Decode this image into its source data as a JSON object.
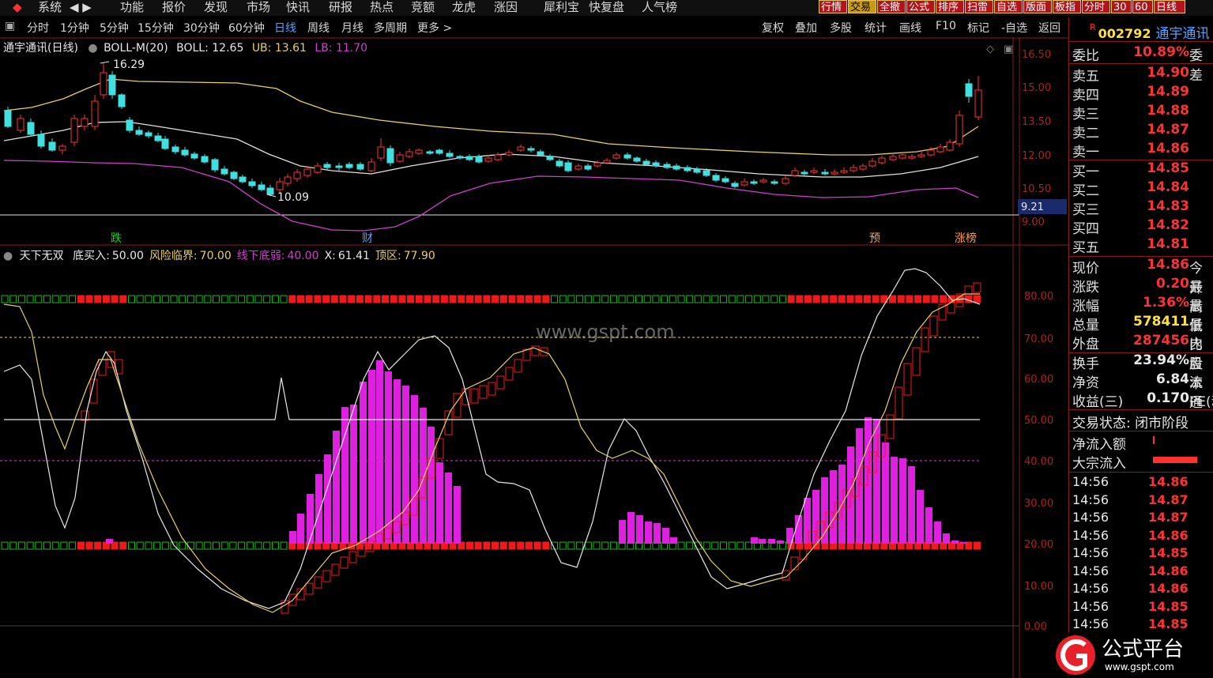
{
  "menu": {
    "left_items": [
      "系统",
      "功能",
      "报价",
      "发现",
      "市场",
      "快讯",
      "研报",
      "热点",
      "竞额",
      "龙虎",
      "涨因",
      "犀利宝",
      "快复盘",
      "人气榜"
    ],
    "right_buttons": [
      "行情",
      "交易",
      "全撤",
      "公式",
      "排序",
      "扫雷",
      "自选",
      "版面",
      "板指",
      "分时",
      "30",
      "60",
      "日线"
    ]
  },
  "toolbar": {
    "periods": [
      "分时",
      "1分钟",
      "5分钟",
      "15分钟",
      "30分钟",
      "60分钟",
      "日线",
      "周线",
      "月线",
      "多周期",
      "更多 >"
    ],
    "active_period": "日线",
    "tools": [
      "复权",
      "叠加",
      "多股",
      "统计",
      "画线",
      "F10",
      "标记",
      "-自选",
      "返回"
    ]
  },
  "price_panel": {
    "title": "通宇通讯(日线)",
    "indicator": "BOLL-M(20)",
    "boll_label": "BOLL: 12.65",
    "ub_label": "UB: 13.61",
    "lb_label": "LB: 11.70",
    "high_label": "16.29",
    "low_label": "10.09",
    "current_marker": "9.21",
    "y_axis": [
      "16.50",
      "15.00",
      "13.50",
      "12.00",
      "10.50",
      "9.00"
    ],
    "event_tags": [
      {
        "text": "跌",
        "color": "#00e600"
      },
      {
        "text": "财",
        "color": "#5aa0ff"
      },
      {
        "text": "预",
        "color": "#ffa040"
      },
      {
        "text": "涨榜",
        "color": "#ffa040"
      }
    ],
    "colors": {
      "boll": "#e0e0e0",
      "ub": "#e8d060",
      "lb": "#d040d0",
      "up": "#ff3232",
      "down": "#40e0e0"
    }
  },
  "indicator_panel": {
    "name": "天下无双",
    "params": [
      {
        "label": "底买入:",
        "value": "50.00",
        "color": "#e8e8e8"
      },
      {
        "label": "风险临界:",
        "value": "70.00",
        "color": "#e8d060"
      },
      {
        "label": "线下底弱:",
        "value": "40.00",
        "color": "#d040d0"
      },
      {
        "label": "X:",
        "value": "61.41",
        "color": "#e8e8e8"
      },
      {
        "label": "顶区:",
        "value": "77.90",
        "color": "#e8d060"
      }
    ],
    "y_axis": [
      "80.00",
      "70.00",
      "60.00",
      "50.00",
      "40.00",
      "30.00",
      "20.00",
      "10.00",
      "0.00"
    ]
  },
  "watermark": "www.gspt.com",
  "quote": {
    "code_prefix": "R",
    "code": "002792",
    "name": "通宇通讯",
    "webi": {
      "label": "委比",
      "value": "10.89%",
      "extra": "委差"
    },
    "asks": [
      {
        "label": "卖五",
        "price": "14.90"
      },
      {
        "label": "卖四",
        "price": "14.89"
      },
      {
        "label": "卖三",
        "price": "14.88"
      },
      {
        "label": "卖二",
        "price": "14.87"
      },
      {
        "label": "卖一",
        "price": "14.86"
      }
    ],
    "bids": [
      {
        "label": "买一",
        "price": "14.85"
      },
      {
        "label": "买二",
        "price": "14.84"
      },
      {
        "label": "买三",
        "price": "14.83"
      },
      {
        "label": "买四",
        "price": "14.82"
      },
      {
        "label": "买五",
        "price": "14.81"
      }
    ],
    "stats1": [
      {
        "label": "现价",
        "value": "14.86",
        "extra": "今开",
        "color": "#ff3232"
      },
      {
        "label": "涨跌",
        "value": "0.20",
        "extra": "最高",
        "color": "#ff3232"
      },
      {
        "label": "涨幅",
        "value": "1.36%",
        "extra": "最低",
        "color": "#ff3232"
      },
      {
        "label": "总量",
        "value": "578411",
        "extra": "量比",
        "color": "#ffe040"
      },
      {
        "label": "外盘",
        "value": "287456",
        "extra": "内盘",
        "color": "#ff3232"
      }
    ],
    "stats2": [
      {
        "label": "换手",
        "value": "23.94%",
        "extra": "股本",
        "color": "#e8e8e8"
      },
      {
        "label": "净资",
        "value": "6.84",
        "extra": "流通",
        "color": "#e8e8e8"
      },
      {
        "label": "收益(三)",
        "value": "0.170",
        "extra": "PE(动)",
        "color": "#e8e8e8"
      }
    ],
    "trade_status": "交易状态: 闭市阶段",
    "net_inflow_label": "净流入额",
    "block_inflow_label": "大宗流入",
    "ticks": [
      {
        "time": "14:56",
        "price": "14.86"
      },
      {
        "time": "14:56",
        "price": "14.87"
      },
      {
        "time": "14:56",
        "price": "14.87"
      },
      {
        "time": "14:56",
        "price": "14.86"
      },
      {
        "time": "14:56",
        "price": "14.85"
      },
      {
        "time": "14:56",
        "price": "14.86"
      },
      {
        "time": "14:56",
        "price": "14.86"
      },
      {
        "time": "14:56",
        "price": "14.85"
      },
      {
        "time": "14:56",
        "price": "14.85"
      }
    ]
  },
  "logo": {
    "text": "公式平台",
    "url_text": "www.gspt.com"
  }
}
